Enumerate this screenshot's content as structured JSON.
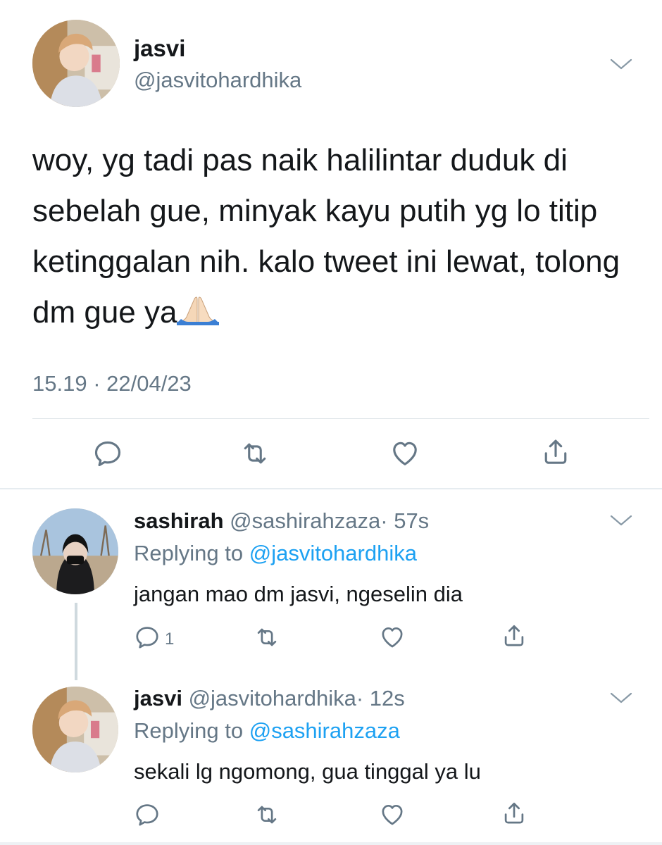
{
  "main_tweet": {
    "name": "jasvi",
    "handle": "@jasvitohardhika",
    "text": "woy, yg tadi pas naik halilintar duduk di sebelah gue, minyak kayu putih yg lo titip ketinggalan nih. kalo tweet ini lewat, tolong dm gue ya",
    "emoji": "folded-hands",
    "timestamp": "15.19 · 22/04/23",
    "actions": [
      "reply-icon",
      "retweet-icon",
      "like-icon",
      "share-icon"
    ]
  },
  "replies": [
    {
      "name": "sashirah",
      "handle": "@sashirahzaza",
      "time": "· 57s",
      "replying_prefix": "Replying to ",
      "replying_to": "@jasvitohardhika",
      "text": "jangan mao dm jasvi, ngeselin dia",
      "reply_count": "1"
    },
    {
      "name": "jasvi",
      "handle": "@jasvitohardhika",
      "time": "· 12s",
      "replying_prefix": "Replying to ",
      "replying_to": "@sashirahzaza",
      "text": "sekali lg ngomong, gua tinggal ya lu",
      "reply_count": ""
    }
  ],
  "colors": {
    "text": "#14171a",
    "secondary": "#657786",
    "link": "#1da1f2",
    "divider": "#dfe5e9"
  }
}
